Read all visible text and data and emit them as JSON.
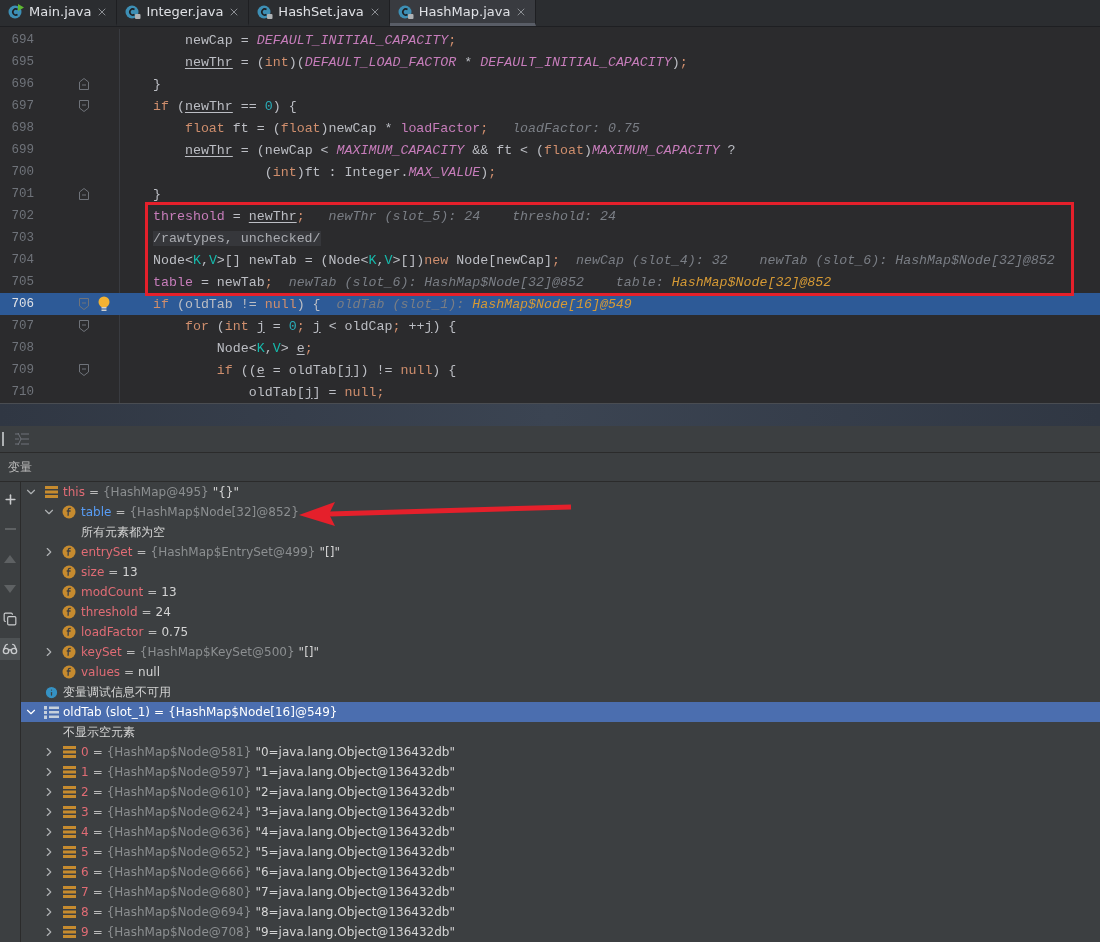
{
  "tabs": [
    {
      "label": "Main.java",
      "selected": false,
      "runnable": true,
      "locked": false
    },
    {
      "label": "Integer.java",
      "selected": false,
      "runnable": false,
      "locked": true
    },
    {
      "label": "HashSet.java",
      "selected": false,
      "runnable": false,
      "locked": true
    },
    {
      "label": "HashMap.java",
      "selected": true,
      "runnable": false,
      "locked": true
    }
  ],
  "editor": {
    "blocks": [
      {
        "boxed": false,
        "lines": [
          {
            "number": "694",
            "current": false,
            "bulb": false,
            "fold_open": false,
            "fold_close": false,
            "segments": [
              {
                "kind": "plain",
                "text": "    newCap = "
              },
              {
                "kind": "const",
                "text": "DEFAULT_INITIAL_CAPACITY"
              },
              {
                "kind": "kw",
                "text": ";"
              }
            ]
          },
          {
            "number": "695",
            "current": false,
            "bulb": false,
            "fold_open": false,
            "fold_close": false,
            "segments": [
              {
                "kind": "under",
                "text": "    newThr"
              },
              {
                "kind": "plain",
                "text": " = ("
              },
              {
                "kind": "kw",
                "text": "int"
              },
              {
                "kind": "plain",
                "text": ")("
              },
              {
                "kind": "const",
                "text": "DEFAULT_LOAD_FACTOR"
              },
              {
                "kind": "plain",
                "text": " * "
              },
              {
                "kind": "const",
                "text": "DEFAULT_INITIAL_CAPACITY"
              },
              {
                "kind": "plain",
                "text": ")"
              },
              {
                "kind": "kw",
                "text": ";"
              }
            ]
          },
          {
            "number": "696",
            "current": false,
            "bulb": false,
            "fold_open": false,
            "fold_close": true,
            "segments": [
              {
                "kind": "plain",
                "text": "}"
              }
            ]
          },
          {
            "number": "697",
            "current": false,
            "bulb": false,
            "fold_open": true,
            "fold_close": false,
            "segments": [
              {
                "kind": "kw",
                "text": "if"
              },
              {
                "kind": "plain",
                "text": " ("
              },
              {
                "kind": "under",
                "text": "newThr"
              },
              {
                "kind": "plain",
                "text": " == "
              },
              {
                "kind": "num",
                "text": "0"
              },
              {
                "kind": "plain",
                "text": ") {"
              }
            ]
          },
          {
            "number": "698",
            "current": false,
            "bulb": false,
            "fold_open": false,
            "fold_close": false,
            "segments": [
              {
                "kind": "kw",
                "text": "    float"
              },
              {
                "kind": "plain",
                "text": " ft = ("
              },
              {
                "kind": "kw",
                "text": "float"
              },
              {
                "kind": "plain",
                "text": ")newCap * "
              },
              {
                "kind": "field",
                "text": "loadFactor"
              },
              {
                "kind": "kw",
                "text": ";"
              },
              {
                "kind": "hint",
                "text": "   loadFactor: 0.75"
              }
            ]
          },
          {
            "number": "699",
            "current": false,
            "bulb": false,
            "fold_open": false,
            "fold_close": false,
            "segments": [
              {
                "kind": "under",
                "text": "    newThr"
              },
              {
                "kind": "plain",
                "text": " = (newCap < "
              },
              {
                "kind": "const",
                "text": "MAXIMUM_CAPACITY"
              },
              {
                "kind": "plain",
                "text": " && ft < ("
              },
              {
                "kind": "kw",
                "text": "float"
              },
              {
                "kind": "plain",
                "text": ")"
              },
              {
                "kind": "const",
                "text": "MAXIMUM_CAPACITY"
              },
              {
                "kind": "plain",
                "text": " ?"
              }
            ]
          },
          {
            "number": "700",
            "current": false,
            "bulb": false,
            "fold_open": false,
            "fold_close": false,
            "segments": [
              {
                "kind": "plain",
                "text": "              ("
              },
              {
                "kind": "kw",
                "text": "int"
              },
              {
                "kind": "plain",
                "text": ")ft : Integer."
              },
              {
                "kind": "const",
                "text": "MAX_VALUE"
              },
              {
                "kind": "plain",
                "text": ")"
              },
              {
                "kind": "kw",
                "text": ";"
              }
            ]
          },
          {
            "number": "701",
            "current": false,
            "bulb": false,
            "fold_open": false,
            "fold_close": true,
            "segments": [
              {
                "kind": "plain",
                "text": "}"
              }
            ]
          }
        ]
      },
      {
        "boxed": true,
        "lines": [
          {
            "number": "702",
            "current": false,
            "bulb": false,
            "fold_open": false,
            "fold_close": false,
            "segments": [
              {
                "kind": "field",
                "text": "threshold"
              },
              {
                "kind": "plain",
                "text": " = "
              },
              {
                "kind": "under",
                "text": "newThr"
              },
              {
                "kind": "kw",
                "text": ";"
              },
              {
                "kind": "hint",
                "text": "   newThr (slot_5): 24    threshold: 24"
              }
            ]
          },
          {
            "number": "703",
            "current": false,
            "bulb": false,
            "fold_open": false,
            "fold_close": false,
            "segments": [
              {
                "kind": "comment",
                "text": "/rawtypes, unchecked/"
              }
            ]
          },
          {
            "number": "704",
            "current": false,
            "bulb": false,
            "fold_open": false,
            "fold_close": false,
            "segments": [
              {
                "kind": "plain",
                "text": "Node<"
              },
              {
                "kind": "generic",
                "text": "K"
              },
              {
                "kind": "plain",
                "text": ","
              },
              {
                "kind": "generic",
                "text": "V"
              },
              {
                "kind": "plain",
                "text": ">[] newTab = (Node<"
              },
              {
                "kind": "generic",
                "text": "K"
              },
              {
                "kind": "plain",
                "text": ","
              },
              {
                "kind": "generic",
                "text": "V"
              },
              {
                "kind": "plain",
                "text": ">[])"
              },
              {
                "kind": "kw",
                "text": "new"
              },
              {
                "kind": "plain",
                "text": " Node[newCap]"
              },
              {
                "kind": "kw",
                "text": ";"
              },
              {
                "kind": "hint",
                "text": "  newCap (slot_4): 32    newTab (slot_6): HashMap$Node[32]@852"
              }
            ]
          },
          {
            "number": "705",
            "current": false,
            "bulb": false,
            "fold_open": false,
            "fold_close": false,
            "segments": [
              {
                "kind": "field",
                "text": "table"
              },
              {
                "kind": "plain",
                "text": " = newTab"
              },
              {
                "kind": "kw",
                "text": ";"
              },
              {
                "kind": "hint",
                "text": "  newTab (slot_6): HashMap$Node[32]@852    table: "
              },
              {
                "kind": "hintval",
                "text": "HashMap$Node[32]@852"
              }
            ]
          }
        ]
      },
      {
        "boxed": false,
        "lines": [
          {
            "number": "706",
            "current": true,
            "bulb": true,
            "fold_open": true,
            "fold_close": false,
            "segments": [
              {
                "kind": "kw",
                "text": "if"
              },
              {
                "kind": "plain",
                "text": " (oldTab != "
              },
              {
                "kind": "kw",
                "text": "null"
              },
              {
                "kind": "plain",
                "text": ") {"
              },
              {
                "kind": "hint",
                "text": "  oldTab (slot_1): "
              },
              {
                "kind": "hintval",
                "text": "HashMap$Node[16]@549"
              }
            ]
          },
          {
            "number": "707",
            "current": false,
            "bulb": false,
            "fold_open": true,
            "fold_close": false,
            "segments": [
              {
                "kind": "kw",
                "text": "    for"
              },
              {
                "kind": "plain",
                "text": " ("
              },
              {
                "kind": "kw",
                "text": "int"
              },
              {
                "kind": "under",
                "text": " j"
              },
              {
                "kind": "plain",
                "text": " = "
              },
              {
                "kind": "num",
                "text": "0"
              },
              {
                "kind": "kw",
                "text": ";"
              },
              {
                "kind": "under",
                "text": " j"
              },
              {
                "kind": "plain",
                "text": " < oldCap"
              },
              {
                "kind": "kw",
                "text": ";"
              },
              {
                "kind": "plain",
                "text": " ++"
              },
              {
                "kind": "under",
                "text": "j"
              },
              {
                "kind": "plain",
                "text": ") {"
              }
            ]
          },
          {
            "number": "708",
            "current": false,
            "bulb": false,
            "fold_open": false,
            "fold_close": false,
            "segments": [
              {
                "kind": "plain",
                "text": "        Node<"
              },
              {
                "kind": "generic",
                "text": "K"
              },
              {
                "kind": "plain",
                "text": ","
              },
              {
                "kind": "generic",
                "text": "V"
              },
              {
                "kind": "plain",
                "text": "> "
              },
              {
                "kind": "under",
                "text": "e"
              },
              {
                "kind": "kw",
                "text": ";"
              }
            ]
          },
          {
            "number": "709",
            "current": false,
            "bulb": false,
            "fold_open": true,
            "fold_close": false,
            "segments": [
              {
                "kind": "kw",
                "text": "        if"
              },
              {
                "kind": "plain",
                "text": " (("
              },
              {
                "kind": "under",
                "text": "e"
              },
              {
                "kind": "plain",
                "text": " = oldTab["
              },
              {
                "kind": "under",
                "text": "j"
              },
              {
                "kind": "plain",
                "text": "]) != "
              },
              {
                "kind": "kw",
                "text": "null"
              },
              {
                "kind": "plain",
                "text": ") {"
              }
            ]
          },
          {
            "number": "710",
            "current": false,
            "bulb": false,
            "fold_open": false,
            "fold_close": false,
            "segments": [
              {
                "kind": "plain",
                "text": "            oldTab["
              },
              {
                "kind": "under",
                "text": "j"
              },
              {
                "kind": "plain",
                "text": "] = "
              },
              {
                "kind": "kw",
                "text": "null"
              },
              {
                "kind": "kw",
                "text": ";"
              }
            ]
          }
        ]
      }
    ]
  },
  "variables": {
    "title": "变量",
    "items": [
      {
        "kind": "object",
        "name": "this",
        "eq": "=",
        "ref": "{HashMap@495}",
        "display": "\"{}\"",
        "expanded": true,
        "selected": false,
        "changed": false,
        "children": [
          {
            "kind": "field",
            "name": "table",
            "eq": "=",
            "ref": "{HashMap$Node[32]@852}",
            "expanded": true,
            "selected": false,
            "changed": true,
            "arrow": true,
            "children": [
              {
                "kind": "message",
                "text": "所有元素都为空"
              }
            ]
          },
          {
            "kind": "field",
            "name": "entrySet",
            "eq": "=",
            "ref": "{HashMap$EntrySet@499}",
            "display": "\"[]\"",
            "expanded": false,
            "selected": false,
            "changed": false,
            "arrow": false
          },
          {
            "kind": "field",
            "name": "size",
            "eq": "=",
            "value": "13",
            "selected": false,
            "changed": false,
            "arrow": false
          },
          {
            "kind": "field",
            "name": "modCount",
            "eq": "=",
            "value": "13",
            "selected": false,
            "changed": false,
            "arrow": false
          },
          {
            "kind": "field",
            "name": "threshold",
            "eq": "=",
            "value": "24",
            "selected": false,
            "changed": false,
            "arrow": false
          },
          {
            "kind": "field",
            "name": "loadFactor",
            "eq": "=",
            "value": "0.75",
            "selected": false,
            "changed": false,
            "arrow": false
          },
          {
            "kind": "field",
            "name": "keySet",
            "eq": "=",
            "ref": "{HashMap$KeySet@500}",
            "display": "\"[]\"",
            "expanded": false,
            "selected": false,
            "changed": false,
            "arrow": false
          },
          {
            "kind": "field",
            "name": "values",
            "eq": "=",
            "value": "null",
            "selected": false,
            "changed": false,
            "arrow": false
          }
        ]
      },
      {
        "kind": "info",
        "text": "变量调试信息不可用"
      },
      {
        "kind": "array",
        "name": "oldTab (slot_1)",
        "eq": "=",
        "ref": "{HashMap$Node[16]@549}",
        "expanded": true,
        "selected": true,
        "changed": false,
        "children": [
          {
            "kind": "message",
            "text": "不显示空元素"
          },
          {
            "kind": "object",
            "name": "0",
            "eq": "=",
            "ref": "{HashMap$Node@581}",
            "display": "\"0=java.lang.Object@136432db\"",
            "expanded": false,
            "selected": false,
            "changed": false
          },
          {
            "kind": "object",
            "name": "1",
            "eq": "=",
            "ref": "{HashMap$Node@597}",
            "display": "\"1=java.lang.Object@136432db\"",
            "expanded": false,
            "selected": false,
            "changed": false
          },
          {
            "kind": "object",
            "name": "2",
            "eq": "=",
            "ref": "{HashMap$Node@610}",
            "display": "\"2=java.lang.Object@136432db\"",
            "expanded": false,
            "selected": false,
            "changed": false
          },
          {
            "kind": "object",
            "name": "3",
            "eq": "=",
            "ref": "{HashMap$Node@624}",
            "display": "\"3=java.lang.Object@136432db\"",
            "expanded": false,
            "selected": false,
            "changed": false
          },
          {
            "kind": "object",
            "name": "4",
            "eq": "=",
            "ref": "{HashMap$Node@636}",
            "display": "\"4=java.lang.Object@136432db\"",
            "expanded": false,
            "selected": false,
            "changed": false
          },
          {
            "kind": "object",
            "name": "5",
            "eq": "=",
            "ref": "{HashMap$Node@652}",
            "display": "\"5=java.lang.Object@136432db\"",
            "expanded": false,
            "selected": false,
            "changed": false
          },
          {
            "kind": "object",
            "name": "6",
            "eq": "=",
            "ref": "{HashMap$Node@666}",
            "display": "\"6=java.lang.Object@136432db\"",
            "expanded": false,
            "selected": false,
            "changed": false
          },
          {
            "kind": "object",
            "name": "7",
            "eq": "=",
            "ref": "{HashMap$Node@680}",
            "display": "\"7=java.lang.Object@136432db\"",
            "expanded": false,
            "selected": false,
            "changed": false
          },
          {
            "kind": "object",
            "name": "8",
            "eq": "=",
            "ref": "{HashMap$Node@694}",
            "display": "\"8=java.lang.Object@136432db\"",
            "expanded": false,
            "selected": false,
            "changed": false
          },
          {
            "kind": "object",
            "name": "9",
            "eq": "=",
            "ref": "{HashMap$Node@708}",
            "display": "\"9=java.lang.Object@136432db\"",
            "expanded": false,
            "selected": false,
            "changed": false
          }
        ]
      }
    ]
  }
}
